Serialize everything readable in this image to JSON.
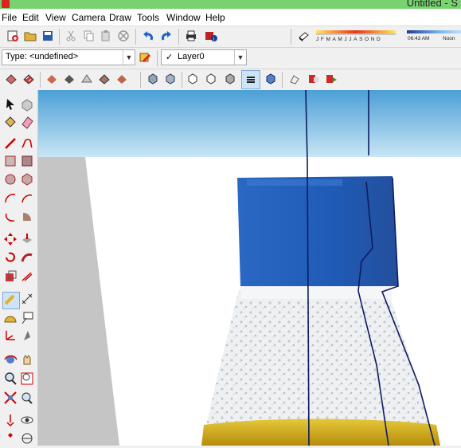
{
  "window": {
    "title": "Untitled - S"
  },
  "menu": [
    "File",
    "Edit",
    "View",
    "Camera",
    "Draw",
    "Tools",
    "Window",
    "Help"
  ],
  "shadow_panel": {
    "months": [
      "J",
      "F",
      "M",
      "A",
      "M",
      "J",
      "J",
      "A",
      "S",
      "O",
      "N",
      "D"
    ],
    "time_label": "06:43 AM",
    "noon_label": "Noon"
  },
  "entity_type": {
    "value": "Type: <undefined>"
  },
  "layer": {
    "check": "✓",
    "value": "Layer0"
  },
  "colors": {
    "sky_top": "#4b9fd6",
    "sky_bottom": "#c9e6f5",
    "ground": "#ffffff",
    "side_wall": "#c5c5c5",
    "cap_blue": "#1f5bb6",
    "bottle_liquid": "#d6b31a",
    "model_line": "#0f1b60"
  }
}
